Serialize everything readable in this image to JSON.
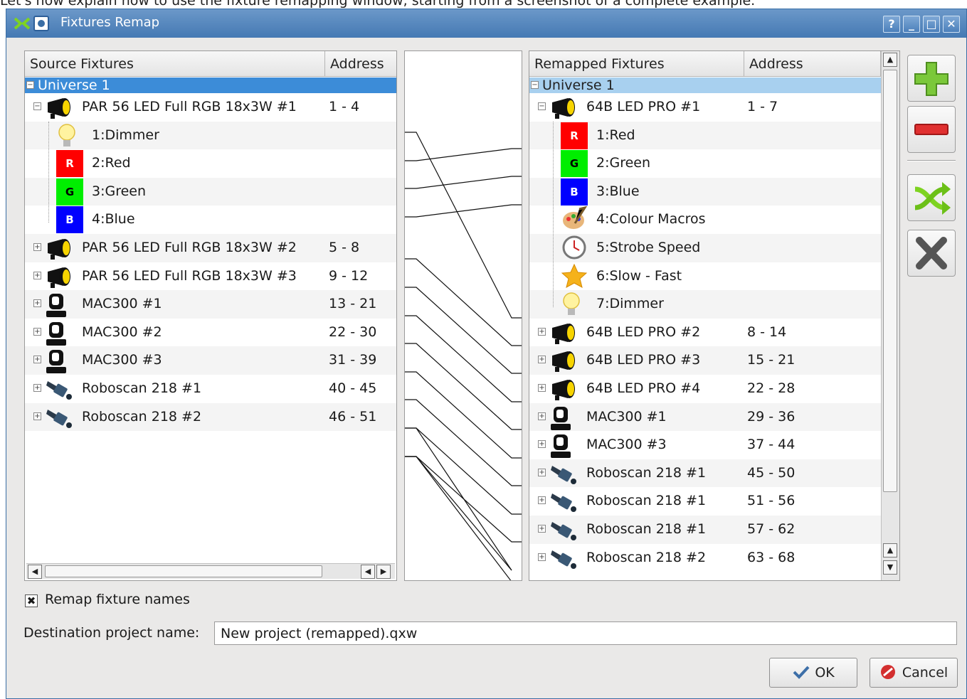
{
  "caption": "Let's now explain how to use the fixture remapping window, starting from a screenshot of a complete example.",
  "window": {
    "title": "Fixtures Remap",
    "buttons": {
      "help": "?",
      "minimize": "_",
      "maximize": "□",
      "close": "✕"
    }
  },
  "source": {
    "header": {
      "name": "Source Fixtures",
      "address": "Address"
    },
    "universe": "Universe 1",
    "items": [
      {
        "name": "PAR 56 LED Full RGB 18x3W #1",
        "address": "1 - 4",
        "icon": "par-can-icon",
        "expanded": true,
        "channels": [
          {
            "name": "1:Dimmer",
            "icon": "bulb-icon"
          },
          {
            "name": "2:Red",
            "icon": "red-channel-icon",
            "badge": "R",
            "color": "#ff0000"
          },
          {
            "name": "3:Green",
            "icon": "green-channel-icon",
            "badge": "G",
            "color": "#00ee00"
          },
          {
            "name": "4:Blue",
            "icon": "blue-channel-icon",
            "badge": "B",
            "color": "#0000ff"
          }
        ]
      },
      {
        "name": "PAR 56 LED Full RGB 18x3W #2",
        "address": "5 - 8",
        "icon": "par-can-icon"
      },
      {
        "name": "PAR 56 LED Full RGB 18x3W #3",
        "address": "9 - 12",
        "icon": "par-can-icon"
      },
      {
        "name": "MAC300 #1",
        "address": "13 - 21",
        "icon": "moving-head-icon"
      },
      {
        "name": "MAC300 #2",
        "address": "22 - 30",
        "icon": "moving-head-icon"
      },
      {
        "name": "MAC300 #3",
        "address": "31 - 39",
        "icon": "moving-head-icon"
      },
      {
        "name": "Roboscan 218 #1",
        "address": "40 - 45",
        "icon": "scanner-icon"
      },
      {
        "name": "Roboscan 218 #2",
        "address": "46 - 51",
        "icon": "scanner-icon"
      }
    ]
  },
  "target": {
    "header": {
      "name": "Remapped Fixtures",
      "address": "Address"
    },
    "universe": "Universe 1",
    "items": [
      {
        "name": "64B LED PRO #1",
        "address": "1 - 7",
        "icon": "par-can-icon",
        "expanded": true,
        "channels": [
          {
            "name": "1:Red",
            "icon": "red-channel-icon",
            "badge": "R",
            "color": "#ff0000"
          },
          {
            "name": "2:Green",
            "icon": "green-channel-icon",
            "badge": "G",
            "color": "#00ee00"
          },
          {
            "name": "3:Blue",
            "icon": "blue-channel-icon",
            "badge": "B",
            "color": "#0000ff"
          },
          {
            "name": "4:Colour Macros",
            "icon": "palette-icon"
          },
          {
            "name": "5:Strobe Speed",
            "icon": "clock-icon"
          },
          {
            "name": "6:Slow - Fast",
            "icon": "star-icon"
          },
          {
            "name": "7:Dimmer",
            "icon": "bulb-icon"
          }
        ]
      },
      {
        "name": "64B LED PRO #2",
        "address": "8 - 14",
        "icon": "par-can-icon"
      },
      {
        "name": "64B LED PRO #3",
        "address": "15 - 21",
        "icon": "par-can-icon"
      },
      {
        "name": "64B LED PRO #4",
        "address": "22 - 28",
        "icon": "par-can-icon"
      },
      {
        "name": "MAC300 #1",
        "address": "29 - 36",
        "icon": "moving-head-icon"
      },
      {
        "name": "MAC300 #3",
        "address": "37 - 44",
        "icon": "moving-head-icon"
      },
      {
        "name": "Roboscan 218 #1",
        "address": "45 - 50",
        "icon": "scanner-icon"
      },
      {
        "name": "Roboscan 218 #1",
        "address": "51 - 56",
        "icon": "scanner-icon"
      },
      {
        "name": "Roboscan 218 #1",
        "address": "57 - 62",
        "icon": "scanner-icon"
      },
      {
        "name": "Roboscan 218 #2",
        "address": "63 - 68",
        "icon": "scanner-icon"
      }
    ]
  },
  "actions": {
    "add": "plus-icon",
    "remove": "minus-icon",
    "clone_remap": "shuffle-icon",
    "delete": "delete-icon"
  },
  "options": {
    "remap_names_label": "Remap fixture names",
    "remap_names_checked": true,
    "destination_label": "Destination project name:",
    "destination_value": "New project (remapped).qxw"
  },
  "footer": {
    "ok_label": "OK",
    "cancel_label": "Cancel"
  },
  "colors": {
    "accent": "#3c8cd8",
    "titlebar": "#4579b3",
    "add": "#7bc83a",
    "remove": "#e03030"
  }
}
